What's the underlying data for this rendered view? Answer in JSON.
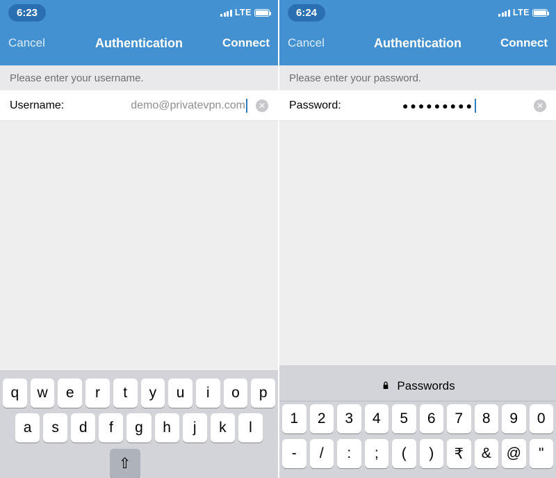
{
  "left": {
    "statusbar": {
      "time": "6:23",
      "network": "LTE"
    },
    "navbar": {
      "cancel": "Cancel",
      "title": "Authentication",
      "connect": "Connect"
    },
    "prompt": "Please enter your username.",
    "field": {
      "label": "Username:",
      "value": "demo@privatevpn.com"
    },
    "keyboard": {
      "row1": [
        "q",
        "w",
        "e",
        "r",
        "t",
        "y",
        "u",
        "i",
        "o",
        "p"
      ],
      "row2": [
        "a",
        "s",
        "d",
        "f",
        "g",
        "h",
        "j",
        "k",
        "l"
      ]
    }
  },
  "right": {
    "statusbar": {
      "time": "6:24",
      "network": "LTE"
    },
    "navbar": {
      "cancel": "Cancel",
      "title": "Authentication",
      "connect": "Connect"
    },
    "prompt": "Please enter your password.",
    "field": {
      "label": "Password:",
      "value": "●●●●●●●●●"
    },
    "suggestion": "Passwords",
    "keyboard": {
      "row1": [
        "1",
        "2",
        "3",
        "4",
        "5",
        "6",
        "7",
        "8",
        "9",
        "0"
      ],
      "row2": [
        "-",
        "/",
        ":",
        ";",
        "(",
        ")",
        "₹",
        "&",
        "@",
        "\""
      ]
    }
  }
}
